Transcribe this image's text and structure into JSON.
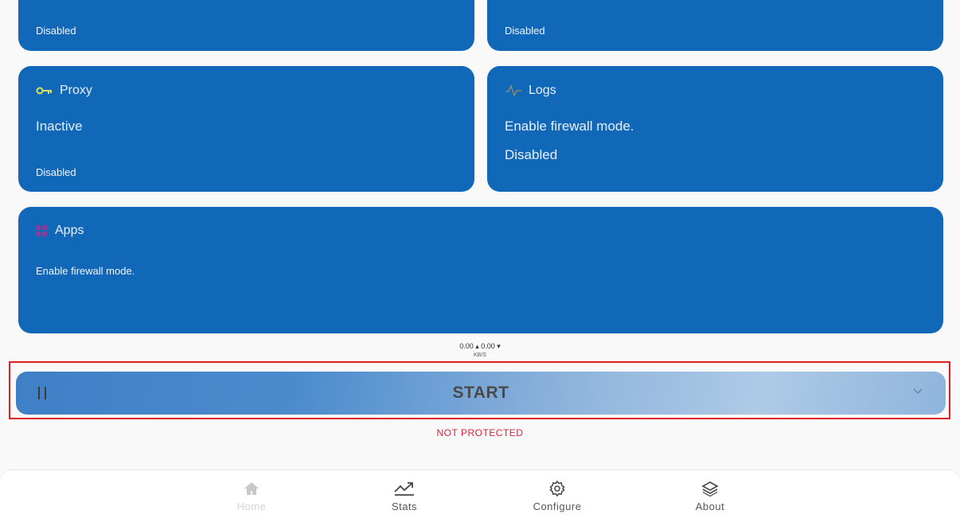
{
  "cards": {
    "top_left": {
      "status": "Disabled"
    },
    "top_right": {
      "status": "Disabled"
    },
    "proxy": {
      "title": "Proxy",
      "value": "Inactive",
      "status": "Disabled",
      "icon": "key-icon"
    },
    "logs": {
      "title": "Logs",
      "value": "Enable firewall mode.",
      "status": "Disabled",
      "icon": "pulse-icon"
    },
    "apps": {
      "title": "Apps",
      "description": "Enable firewall mode.",
      "icon": "grid-icon"
    }
  },
  "traffic": {
    "rates": "0.00 ▴ 0.00 ▾",
    "unit": "KB/S"
  },
  "start_button": {
    "label": "START"
  },
  "protection_status": "NOT PROTECTED",
  "bottom_nav": {
    "items": [
      {
        "label": "Home",
        "icon": "home-icon",
        "active": false
      },
      {
        "label": "Stats",
        "icon": "stats-icon"
      },
      {
        "label": "Configure",
        "icon": "gear-icon"
      },
      {
        "label": "About",
        "icon": "layers-icon"
      }
    ]
  },
  "colors": {
    "card": "#1167b8",
    "status_alert": "#e0203a",
    "highlight": "#e02020"
  }
}
